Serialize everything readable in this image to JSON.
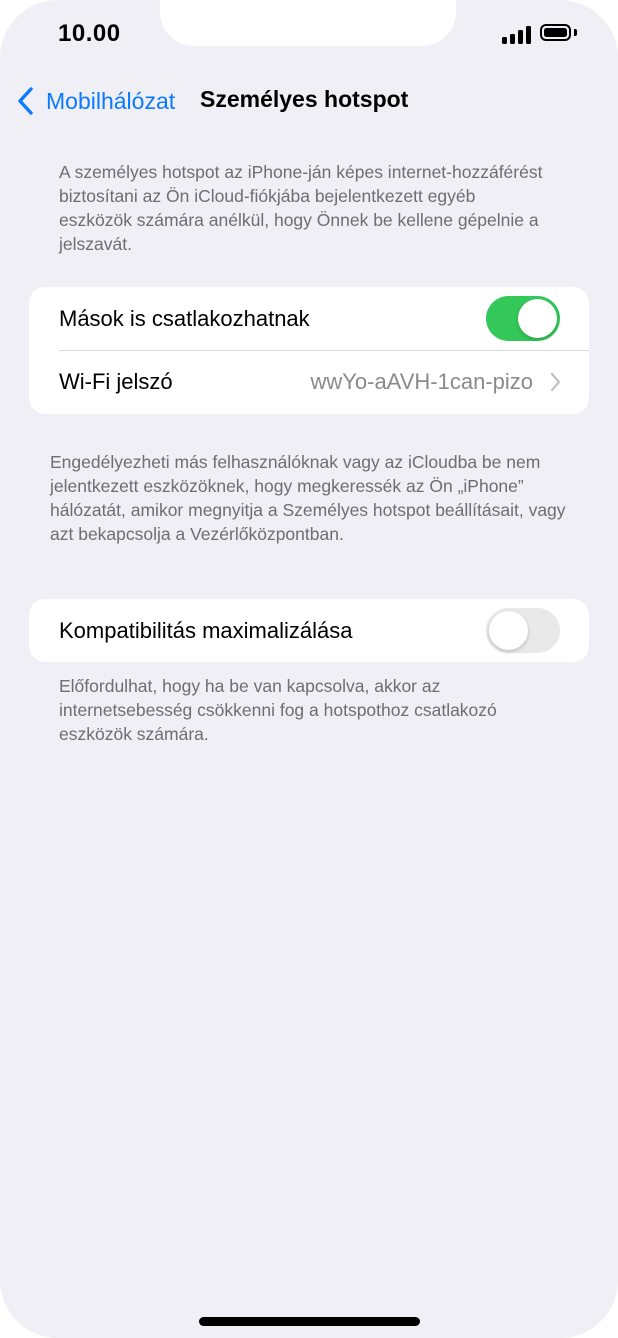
{
  "status_bar": {
    "time": "10.00"
  },
  "nav": {
    "back_label": "Mobilhálózat",
    "title": "Személyes hotspot"
  },
  "intro_text": "A személyes hotspot az iPhone-ján képes internet-hozzáférést biztosítani az Ön iCloud-fiókjába bejelentkezett egyéb eszközök számára anélkül, hogy Önnek be kellene gépelnie a jelszavát.",
  "settings": {
    "allow_others": {
      "label": "Mások is csatlakozhatnak",
      "enabled": true
    },
    "wifi_password": {
      "label": "Wi-Fi jelszó",
      "value": "wwYo-aAVH-1can-pizo"
    },
    "allow_others_footer": "Engedélyezheti más felhasználóknak vagy az iCloudba be nem jelentkezett eszközöknek, hogy megkeressék az Ön „iPhone” hálózatát, amikor megnyitja a Személyes hotspot beállításait, vagy azt bekapcsolja a Vezérlőközpontban.",
    "max_compat": {
      "label": "Kompatibilitás maximalizálása",
      "enabled": false
    },
    "max_compat_footer": "Előfordulhat, hogy ha be van kapcsolva, akkor az internetsebesség csökkenni fog a hotspothoz csatlakozó eszközök számára."
  },
  "colors": {
    "accent": "#0a7aff",
    "toggle_on": "#34c759",
    "toggle_off": "#e9e9ea",
    "background": "#f0eff5"
  },
  "icons": {
    "back": "chevron-left-icon",
    "disclosure": "chevron-right-icon",
    "signal": "cellular-signal-icon",
    "battery": "battery-icon"
  }
}
